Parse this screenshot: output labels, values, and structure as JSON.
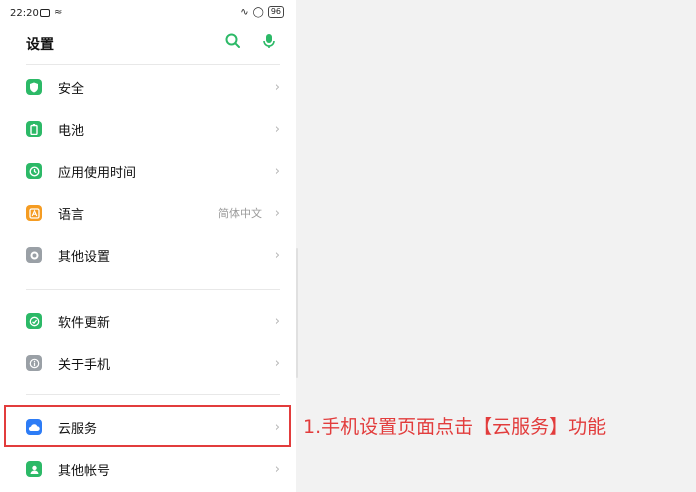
{
  "status_bar": {
    "time": "22:20",
    "battery": "96"
  },
  "header": {
    "title": "设置"
  },
  "items": [
    {
      "label": "安全",
      "value": "",
      "icon": "shield-icon",
      "color": "#2cb967"
    },
    {
      "label": "电池",
      "value": "",
      "icon": "battery-icon",
      "color": "#2cb967"
    },
    {
      "label": "应用使用时间",
      "value": "",
      "icon": "app-usage-icon",
      "color": "#2cb967"
    },
    {
      "label": "语言",
      "value": "简体中文",
      "icon": "language-icon",
      "color": "#f59c22"
    },
    {
      "label": "其他设置",
      "value": "",
      "icon": "other-settings-icon",
      "color": "#9aa0a6"
    },
    {
      "label": "软件更新",
      "value": "",
      "icon": "update-icon",
      "color": "#2cb967"
    },
    {
      "label": "关于手机",
      "value": "",
      "icon": "info-icon",
      "color": "#9aa0a6"
    },
    {
      "label": "云服务",
      "value": "",
      "icon": "cloud-icon",
      "color": "#2d7cf6"
    },
    {
      "label": "其他帐号",
      "value": "",
      "icon": "account-icon",
      "color": "#2cb967"
    }
  ],
  "annotation": {
    "text": "1.手机设置页面点击【云服务】功能",
    "color": "#e23c3c"
  }
}
